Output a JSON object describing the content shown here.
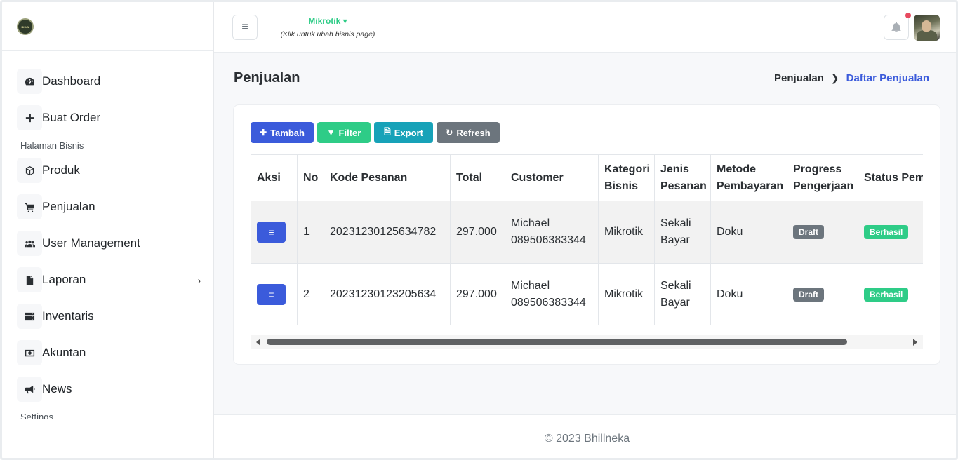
{
  "logo": {
    "text": "BHLN"
  },
  "sidebar": {
    "items": [
      {
        "label": "Dashboard",
        "icon": "dashboard-icon"
      },
      {
        "label": "Buat Order",
        "icon": "plus-icon"
      },
      {
        "label": "Produk",
        "icon": "box-icon"
      },
      {
        "label": "Penjualan",
        "icon": "cart-icon"
      },
      {
        "label": "User Management",
        "icon": "users-icon"
      },
      {
        "label": "Laporan",
        "icon": "file-icon"
      },
      {
        "label": "Inventaris",
        "icon": "server-icon"
      },
      {
        "label": "Akuntan",
        "icon": "money-icon"
      },
      {
        "label": "News",
        "icon": "bullhorn-icon"
      }
    ],
    "section_business": "Halaman Bisnis",
    "section_settings": "Settings"
  },
  "topbar": {
    "business_name": "Mikrotik",
    "business_hint": "(Klik untuk ubah bisnis page)"
  },
  "page": {
    "title": "Penjualan",
    "breadcrumb": [
      "Penjualan",
      "Daftar Penjualan"
    ]
  },
  "toolbar": {
    "tambah": "Tambah",
    "filter": "Filter",
    "export": "Export",
    "refresh": "Refresh"
  },
  "table": {
    "headers": [
      "Aksi",
      "No",
      "Kode Pesanan",
      "Total",
      "Customer",
      "Kategori Bisnis",
      "Jenis Pesanan",
      "Metode Pembayaran",
      "Progress Pengerjaan",
      "Status Pembayaran"
    ],
    "rows": [
      {
        "no": "1",
        "kode": "20231230125634782",
        "total": "297.000",
        "customer_name": "Michael",
        "customer_phone": "089506383344",
        "kategori": "Mikrotik",
        "jenis": "Sekali Bayar",
        "metode": "Doku",
        "progress": "Draft",
        "status": "Berhasil"
      },
      {
        "no": "2",
        "kode": "20231230123205634",
        "total": "297.000",
        "customer_name": "Michael",
        "customer_phone": "089506383344",
        "kategori": "Mikrotik",
        "jenis": "Sekali Bayar",
        "metode": "Doku",
        "progress": "Draft",
        "status": "Berhasil"
      }
    ]
  },
  "footer": {
    "text": "© 2023 Bhillneka"
  },
  "colors": {
    "primary": "#3b5bdb",
    "success": "#2ecc87",
    "info": "#17a2b8",
    "secondary": "#6c757d",
    "notification": "#e74a5f"
  }
}
